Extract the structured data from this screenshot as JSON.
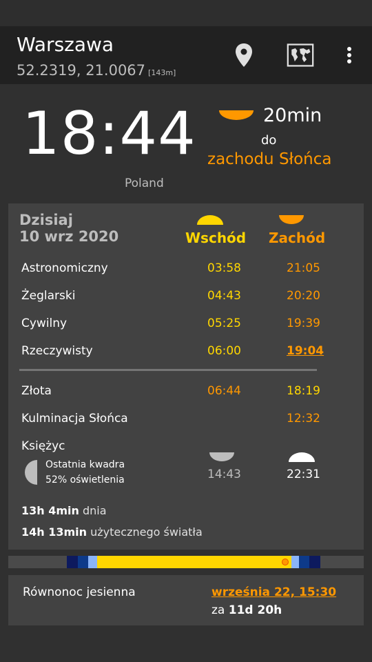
{
  "appbar": {
    "city": "Warszawa",
    "coords": "52.2319, 21.0067",
    "altitude": "[143m]",
    "icons": [
      "location-pin-icon",
      "map-icon",
      "more-vert-icon"
    ]
  },
  "clock": {
    "time": "18:44",
    "country": "Poland"
  },
  "countdown": {
    "value": "20min",
    "prep": "do",
    "event": "zachodu Słońca"
  },
  "card": {
    "today": "Dzisiaj",
    "date": "10 wrz 2020",
    "col_sunrise": "Wschód",
    "col_sunset": "Zachód",
    "rows": [
      {
        "label": "Astronomiczny",
        "rise": "03:58",
        "set": "21:05"
      },
      {
        "label": "Żeglarski",
        "rise": "04:43",
        "set": "20:20"
      },
      {
        "label": "Cywilny",
        "rise": "05:25",
        "set": "19:39"
      },
      {
        "label": "Rzeczywisty",
        "rise": "06:00",
        "set": "19:04"
      }
    ],
    "golden": {
      "label": "Złota",
      "rise": "06:44",
      "set": "18:19"
    },
    "noon": {
      "label": "Kulminacja Słońca",
      "time": "12:32"
    },
    "moon": {
      "label": "Księżyc",
      "phase": "Ostatnia kwadra",
      "illumination": "52% oświetlenia",
      "rise": "14:43",
      "set": "22:31"
    },
    "day_length_value": "13h 4min",
    "day_length_text": "dnia",
    "useful_light_value": "14h 13min",
    "useful_light_text": "użytecznego światła"
  },
  "timeline": {
    "colors": {
      "night": "#0d1a5e",
      "astro": "#0d3a8a",
      "twilight": "#8ab4f8",
      "day": "#ffd600",
      "marker": "#ff9800"
    }
  },
  "equinox": {
    "label": "Równonoc jesienna",
    "date": "września 22, 15:30",
    "in_prefix": "za",
    "in_value": "11d 20h"
  },
  "colors": {
    "sunrise": "#ffd600",
    "sunset": "#ff9800",
    "background": "#303030",
    "card": "#424242"
  }
}
